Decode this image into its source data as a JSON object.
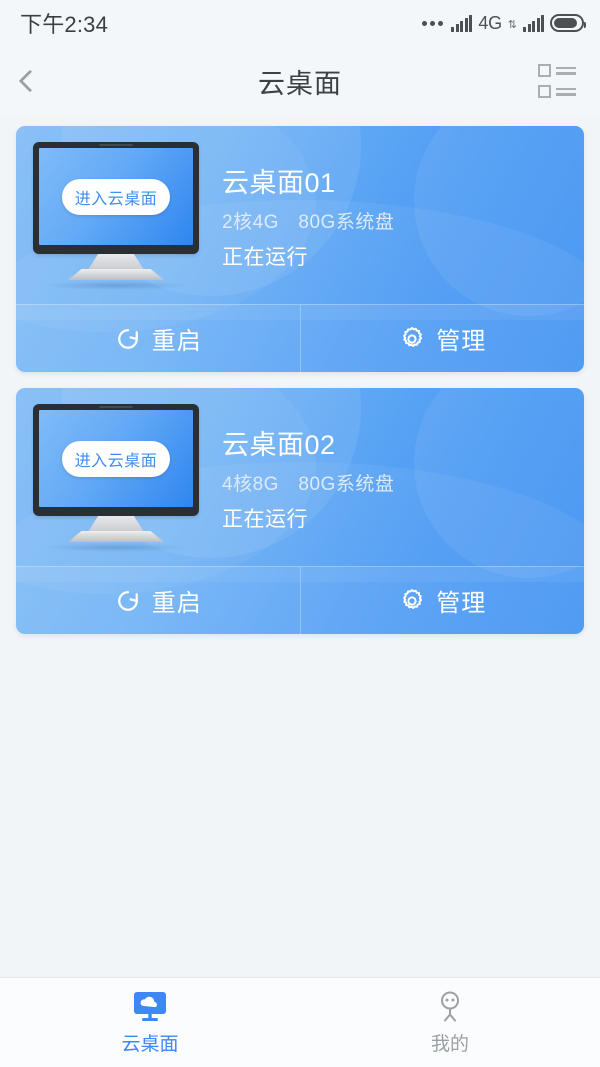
{
  "statusbar": {
    "time": "下午2:34",
    "network_label": "4G",
    "icons": [
      "more-dots",
      "signal-bars",
      "network-type",
      "data-transfer-arrows",
      "signal-bars-2",
      "battery"
    ]
  },
  "header": {
    "back_icon": "chevron-left-icon",
    "title": "云桌面",
    "menu_icon": "list-view-icon"
  },
  "cards": [
    {
      "enter_label": "进入云桌面",
      "title": "云桌面01",
      "spec": "2核4G　80G系统盘",
      "status": "正在运行",
      "restart_label": "重启",
      "manage_label": "管理"
    },
    {
      "enter_label": "进入云桌面",
      "title": "云桌面02",
      "spec": "4核8G　80G系统盘",
      "status": "正在运行",
      "restart_label": "重启",
      "manage_label": "管理"
    }
  ],
  "tabbar": {
    "items": [
      {
        "label": "云桌面",
        "icon": "cloud-desktop-icon",
        "active": true
      },
      {
        "label": "我的",
        "icon": "person-icon",
        "active": false
      }
    ]
  },
  "colors": {
    "page_bg": "#f2f5f8",
    "card_gradient_start": "#84bdf6",
    "card_gradient_end": "#3d90f2",
    "accent": "#3f87f5",
    "inactive": "#9aa0a6",
    "text_dark": "#3c4146"
  }
}
